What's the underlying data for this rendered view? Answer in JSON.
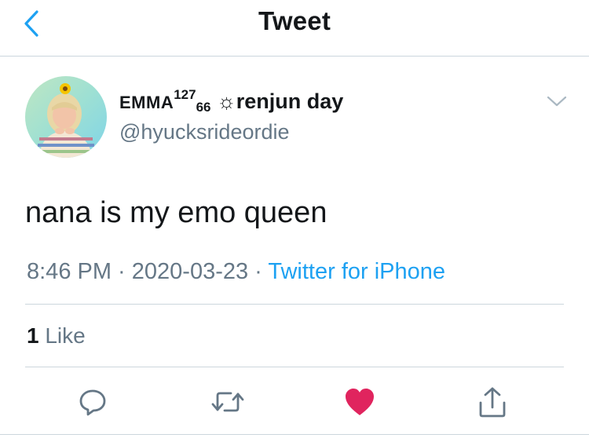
{
  "navbar": {
    "title": "Tweet",
    "back_icon": "chevron-left-icon"
  },
  "author": {
    "name_prefix": "EMMA",
    "name_sup": "127",
    "name_sub": "66",
    "name_suffix": " ☼renjun day",
    "handle": "@hyucksrideordie",
    "avatar_icon": "user-avatar"
  },
  "tweet": {
    "text": "nana is my emo queen",
    "time": "8:46 PM",
    "separator": " · ",
    "date": "2020-03-23",
    "source": "Twitter for iPhone"
  },
  "stats": {
    "likes_count": "1",
    "likes_label": " Like"
  },
  "actions": {
    "reply_icon": "reply-icon",
    "retweet_icon": "retweet-icon",
    "like_icon": "heart-icon",
    "share_icon": "share-icon"
  },
  "colors": {
    "accent": "#1da1f2",
    "like": "#e0245e",
    "secondary_text": "#657786",
    "icon": "#657786",
    "divider": "#ccd6dd"
  }
}
